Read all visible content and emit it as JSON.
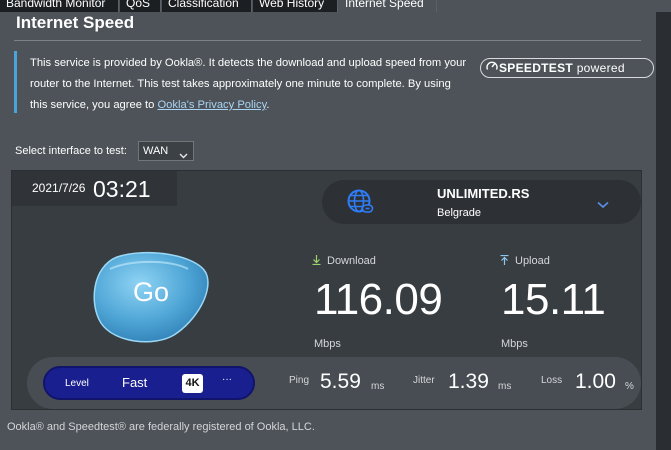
{
  "tabs": [
    "Bandwidth Monitor",
    "QoS",
    "Classification",
    "Web History",
    "Internet Speed"
  ],
  "page_title": "Internet Speed",
  "notice": {
    "text": "This service is provided by Ookla®. It detects the download and upload speed from your router to the Internet. This test takes approximately one minute to complete. By using this service, you agree to ",
    "link": "Ookla's Privacy Policy",
    "after": ".",
    "badge_bold": "SPEEDTEST",
    "badge_light": " powered"
  },
  "interface": {
    "label": "Select interface to test:",
    "value": "WAN"
  },
  "test": {
    "date": "2021/7/26",
    "time": "03:21",
    "server_name": "UNLIMITED.RS",
    "server_city": "Belgrade",
    "go_label": "Go",
    "download_label": "Download",
    "download_value": "116.09",
    "download_unit": "Mbps",
    "upload_label": "Upload",
    "upload_value": "15.11",
    "upload_unit": "Mbps"
  },
  "level": {
    "label": "Level",
    "value": "Fast",
    "badge": "4K",
    "more": "···"
  },
  "stats": {
    "ping_label": "Ping",
    "ping_value": "5.59",
    "ping_unit": "ms",
    "jitter_label": "Jitter",
    "jitter_value": "1.39",
    "jitter_unit": "ms",
    "loss_label": "Loss",
    "loss_value": "1.00",
    "loss_unit": "%"
  },
  "footer": "Ookla® and Speedtest® are federally registered of Ookla, LLC.",
  "colors": {
    "accent": "#4aa4d9",
    "go_button": "#5bb0dc",
    "level_pill": "#1a1f8f",
    "background": "#4d5358"
  },
  "icons": [
    "globe-icon",
    "chevron-down-icon",
    "download-arrow-icon",
    "upload-arrow-icon",
    "speedtest-logo-icon"
  ]
}
